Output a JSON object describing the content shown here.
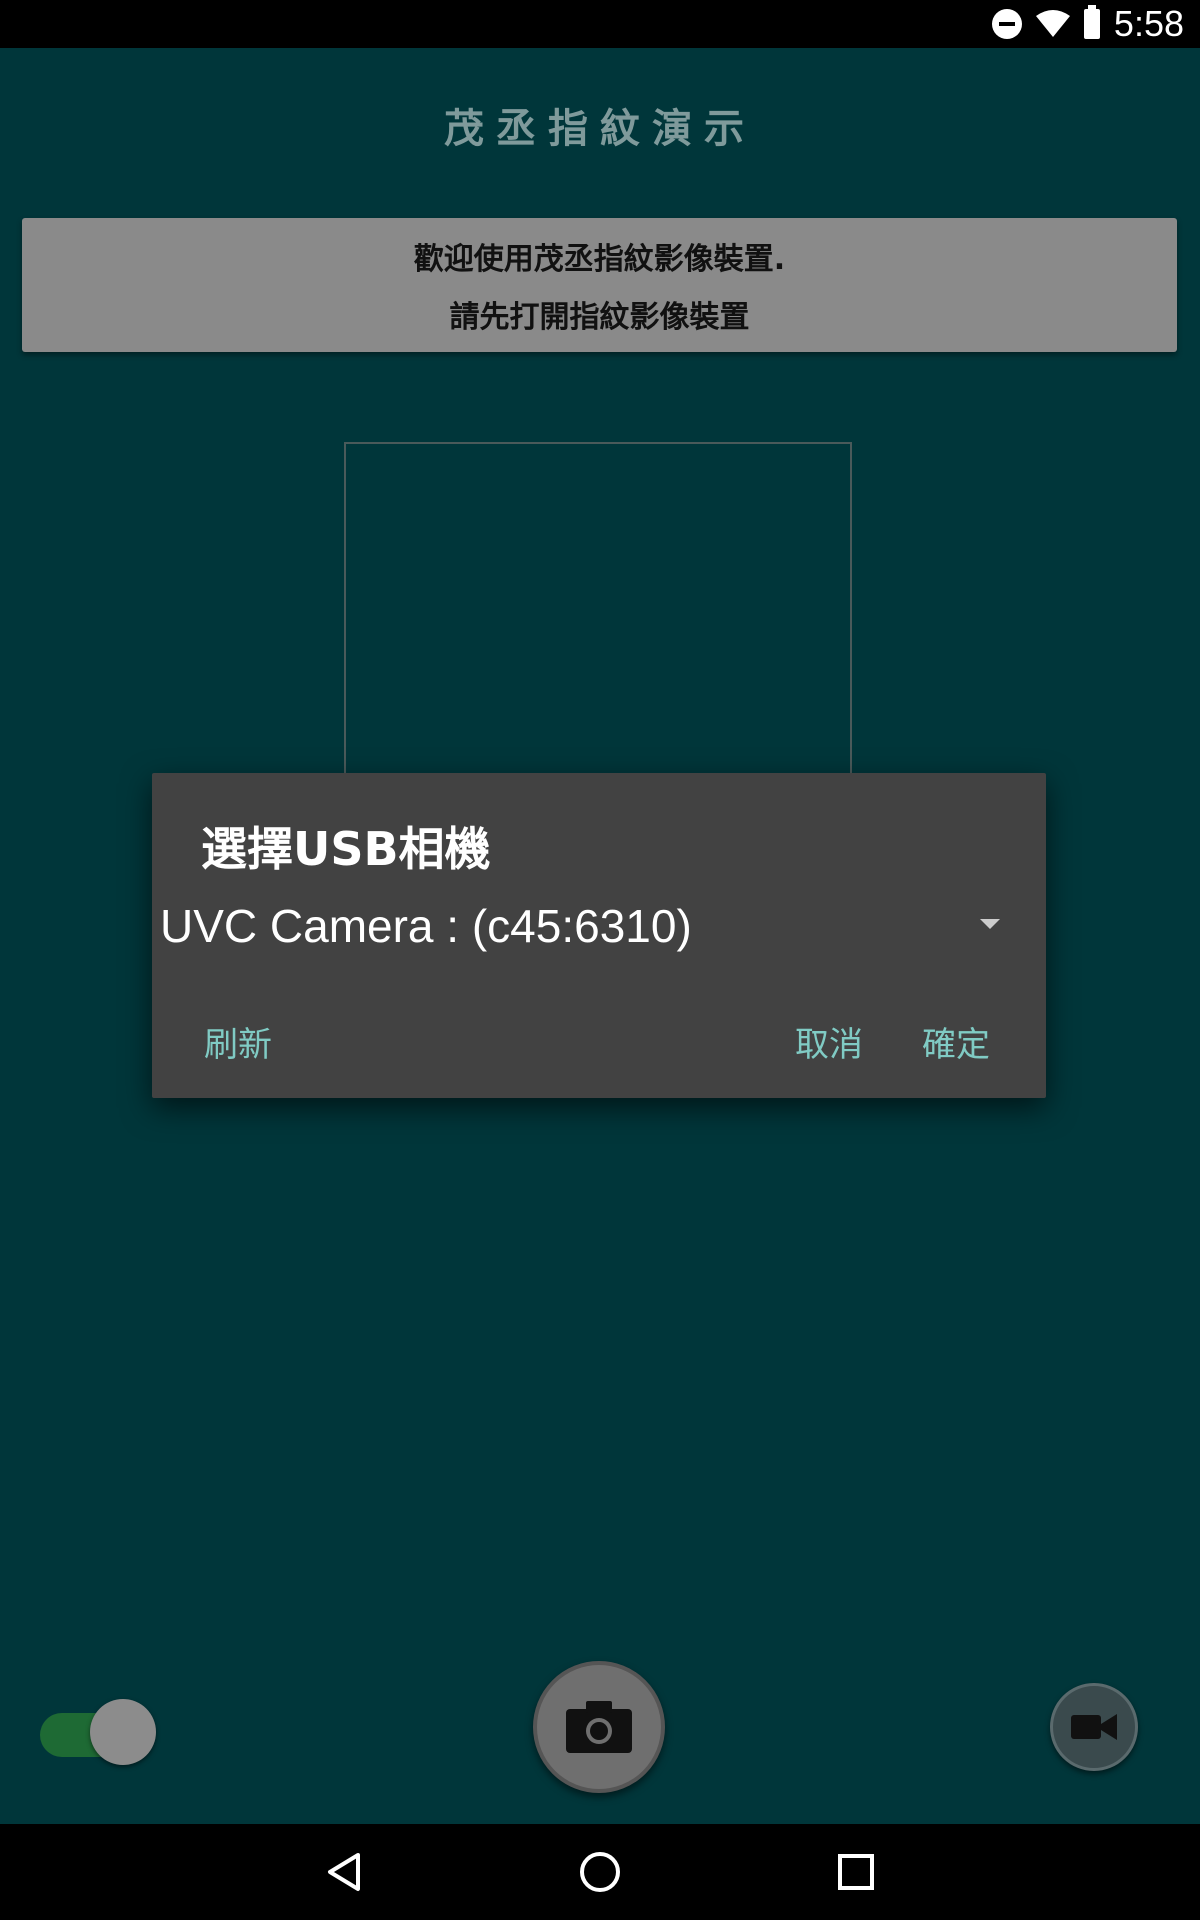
{
  "status_bar": {
    "time": "5:58",
    "icons": [
      "do-not-disturb-icon",
      "wifi-icon",
      "battery-icon"
    ]
  },
  "app": {
    "title": "茂丞指紋演示"
  },
  "banner": {
    "line1": "歡迎使用茂丞指紋影像裝置.",
    "line2": "請先打開指紋影像裝置"
  },
  "dialog": {
    "title": "選擇USB相機",
    "selected_camera": "UVC Camera : (c45:6310)",
    "refresh_label": "刷新",
    "cancel_label": "取消",
    "ok_label": "確定"
  },
  "controls": {
    "toggle_on": true,
    "capture_icon": "camera-icon",
    "record_icon": "video-camera-icon"
  },
  "nav_bar": {
    "icons": [
      "back-icon",
      "home-icon",
      "recents-icon"
    ]
  },
  "colors": {
    "background": "#00363a",
    "dialog": "#424242",
    "accent": "#80cbc4",
    "toggle_track": "#1e6a34"
  }
}
